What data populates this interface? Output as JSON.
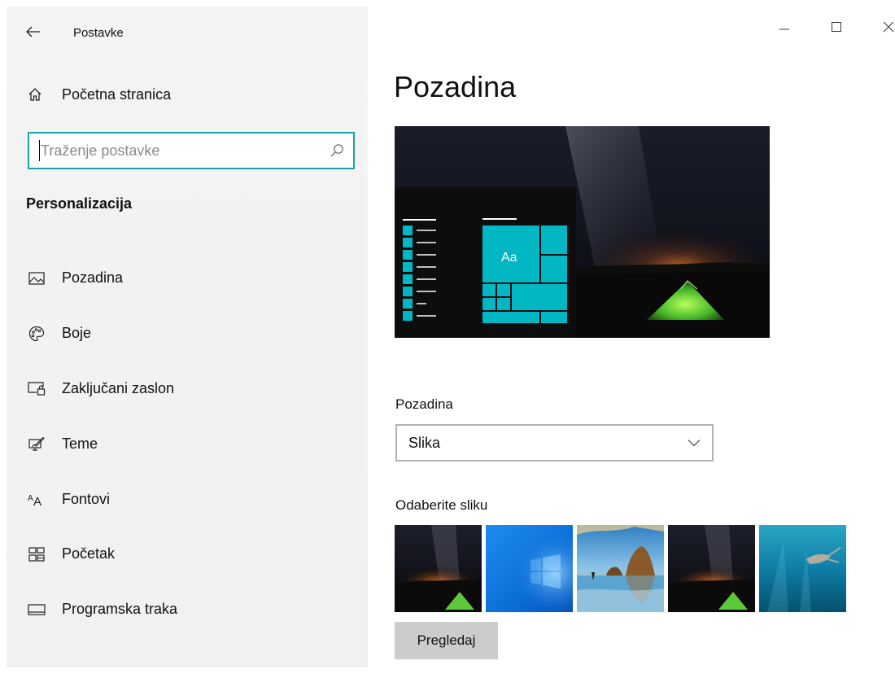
{
  "window": {
    "title": "Postavke",
    "controls": {
      "minimize_icon": "minimize-icon",
      "maximize_icon": "maximize-icon",
      "close_icon": "close-icon"
    }
  },
  "sidebar": {
    "home_label": "Početna stranica",
    "search_placeholder": "Traženje postavke",
    "section_title": "Personalizacija",
    "items": [
      {
        "label": "Pozadina",
        "icon": "picture-icon"
      },
      {
        "label": "Boje",
        "icon": "palette-icon"
      },
      {
        "label": "Zaključani zaslon",
        "icon": "lock-screen-icon"
      },
      {
        "label": "Teme",
        "icon": "themes-icon"
      },
      {
        "label": "Fontovi",
        "icon": "fonts-icon"
      },
      {
        "label": "Početak",
        "icon": "start-icon"
      },
      {
        "label": "Programska traka",
        "icon": "taskbar-icon"
      }
    ]
  },
  "main": {
    "title": "Pozadina",
    "preview": {
      "tile_label": "Aa",
      "accent_color": "#00b7c3"
    },
    "background_label": "Pozadina",
    "background_value": "Slika",
    "choose_label": "Odaberite sliku",
    "thumbnails": [
      {
        "name": "milky-way-tent"
      },
      {
        "name": "windows-blue"
      },
      {
        "name": "beach-rocks"
      },
      {
        "name": "milky-way-tent-2"
      },
      {
        "name": "underwater-swimmer"
      }
    ],
    "browse_label": "Pregledaj"
  }
}
